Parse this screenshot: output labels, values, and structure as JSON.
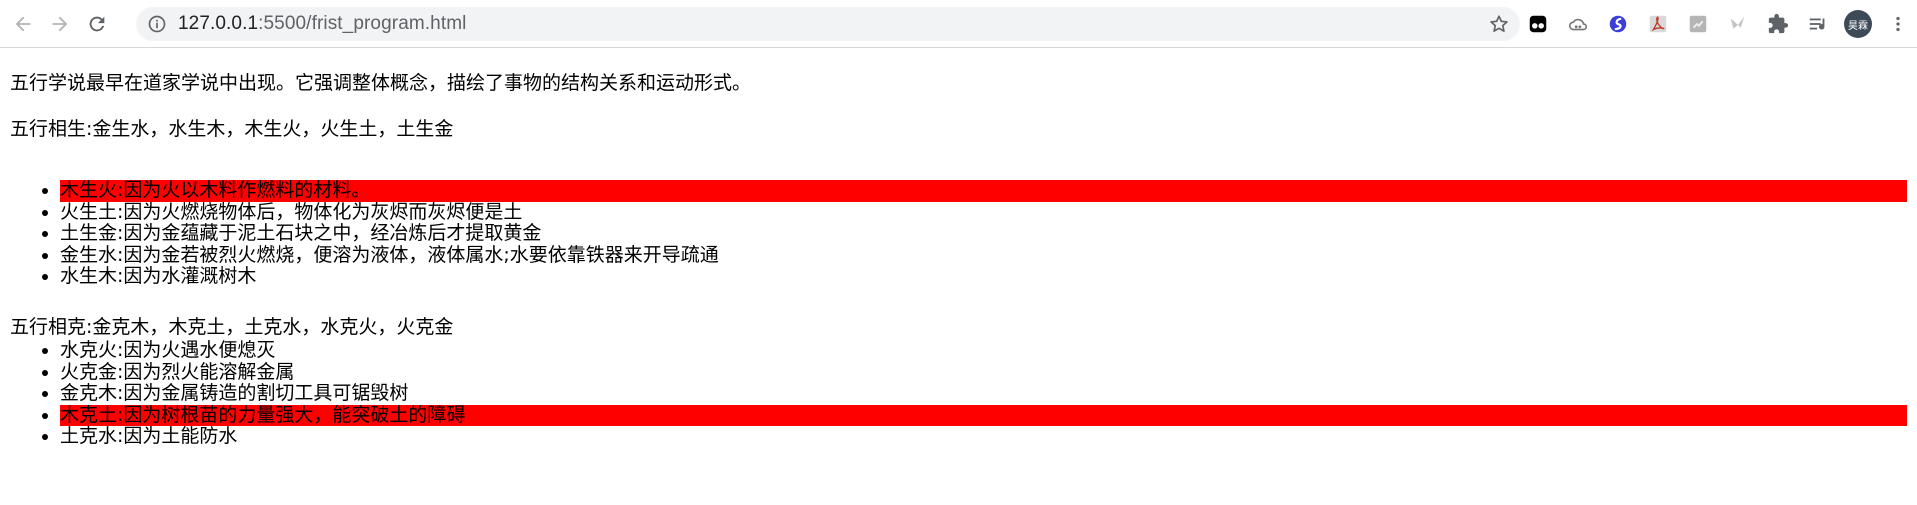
{
  "browser": {
    "url_host": "127.0.0.1",
    "url_path": ":5500/frist_program.html",
    "avatar_text": "昊霖",
    "extensions": [
      "tampermonkey-icon",
      "cloud-link-icon",
      "s-logo-icon",
      "pdf-icon",
      "puzzle-gray-icon",
      "bird-icon",
      "extensions-icon",
      "reading-list-icon"
    ]
  },
  "page": {
    "intro": "五行学说最早在道家学说中出现。它强调整体概念，描绘了事物的结构关系和运动形式。",
    "sheng_title": "五行相生:金生水，水生木，木生火，火生土，土生金",
    "sheng_items": [
      {
        "text": "木生火:因为火以木料作燃料的材料。",
        "highlight": true
      },
      {
        "text": "火生土:因为火燃烧物体后，物体化为灰烬而灰烬便是土",
        "highlight": false
      },
      {
        "text": "土生金:因为金蕴藏于泥土石块之中，经冶炼后才提取黄金",
        "highlight": false
      },
      {
        "text": "金生水:因为金若被烈火燃烧，便溶为液体，液体属水;水要依靠铁器来开导疏通",
        "highlight": false
      },
      {
        "text": "水生木:因为水灌溉树木",
        "highlight": false
      }
    ],
    "ke_title": "五行相克:金克木，木克土，土克水，水克火，火克金",
    "ke_items": [
      {
        "text": "水克火:因为火遇水便熄灭",
        "highlight": false
      },
      {
        "text": "火克金:因为烈火能溶解金属",
        "highlight": false
      },
      {
        "text": "金克木:因为金属铸造的割切工具可锯毁树",
        "highlight": false
      },
      {
        "text": "木克土:因为树根苗的力量强大，能突破土的障碍",
        "highlight": true
      },
      {
        "text": "土克水:因为土能防水",
        "highlight": false
      }
    ],
    "highlight_color": "#ff0000"
  }
}
